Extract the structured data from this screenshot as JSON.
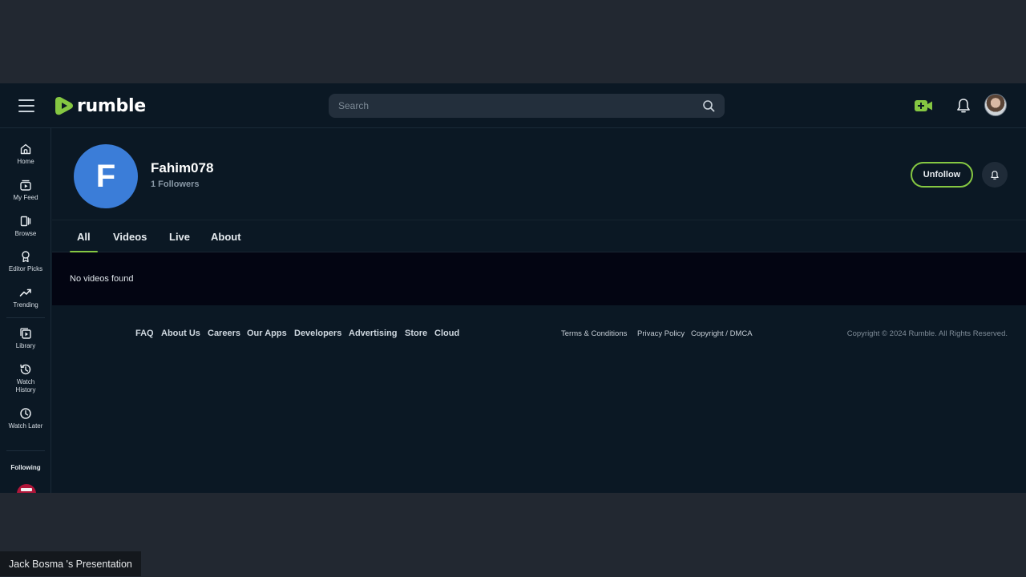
{
  "header": {
    "brand": "rumble",
    "search_placeholder": "Search",
    "search_value": "",
    "icons": {
      "menu": "hamburger-icon",
      "search": "search-icon",
      "upload": "video-plus-icon",
      "notifications": "bell-icon",
      "account": "user-avatar"
    }
  },
  "sidebar": {
    "items": [
      {
        "label": "Home",
        "icon": "home-icon"
      },
      {
        "label": "My Feed",
        "icon": "feed-icon"
      },
      {
        "label": "Browse",
        "icon": "browse-icon"
      },
      {
        "label": "Editor Picks",
        "icon": "award-icon"
      },
      {
        "label": "Trending",
        "icon": "trending-icon"
      },
      {
        "label": "Library",
        "icon": "library-icon"
      },
      {
        "label": "Watch History",
        "icon": "history-icon"
      },
      {
        "label": "Watch Later",
        "icon": "clock-icon"
      }
    ],
    "following_label": "Following"
  },
  "channel": {
    "avatar_letter": "F",
    "name": "Fahim078",
    "followers": "1 Followers",
    "unfollow_label": "Unfollow",
    "colors": {
      "avatar": "#3b7dd8",
      "accent": "#85c742"
    }
  },
  "tabs": [
    {
      "label": "All",
      "active": true
    },
    {
      "label": "Videos",
      "active": false
    },
    {
      "label": "Live",
      "active": false
    },
    {
      "label": "About",
      "active": false
    }
  ],
  "content": {
    "empty_message": "No videos found"
  },
  "footer": {
    "links": [
      "FAQ",
      "About Us",
      "Careers",
      "Our Apps",
      "Developers",
      "Advertising",
      "Store",
      "Cloud"
    ],
    "legal": [
      "Terms & Conditions",
      "Privacy Policy",
      "Copyright / DMCA"
    ],
    "copyright": "Copyright © 2024 Rumble. All Rights Reserved."
  },
  "presentation": {
    "label": "Jack Bosma 's Presentation"
  }
}
